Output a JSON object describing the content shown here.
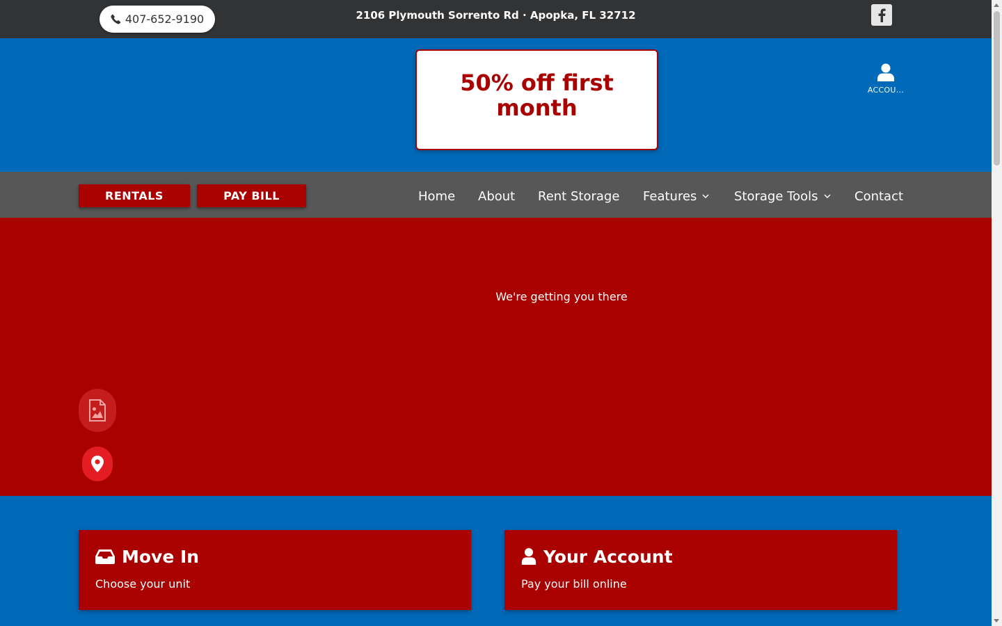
{
  "topbar": {
    "phone": "407-652-9190",
    "address": "2106 Plymouth Sorrento Rd · Apopka, FL 32712",
    "social_icon": "facebook-icon"
  },
  "header": {
    "promo": "50% off first month",
    "account_label": "ACCOU..."
  },
  "nav": {
    "rentals_label": "RENTALS",
    "pay_bill_label": "PAY BILL",
    "items": [
      {
        "label": "Home"
      },
      {
        "label": "About"
      },
      {
        "label": "Rent Storage"
      },
      {
        "label": "Features"
      },
      {
        "label": "Storage Tools"
      },
      {
        "label": "Contact"
      }
    ]
  },
  "hero": {
    "message": "We're getting you there"
  },
  "cards": {
    "move_in": {
      "title": "Move In",
      "subtitle": "Choose your unit"
    },
    "your_account": {
      "title": "Your Account",
      "subtitle": "Pay your bill online"
    }
  },
  "colors": {
    "brand_red": "#a90000",
    "brand_blue": "#0069b8",
    "topbar": "#323335",
    "navbar": "#575757"
  }
}
